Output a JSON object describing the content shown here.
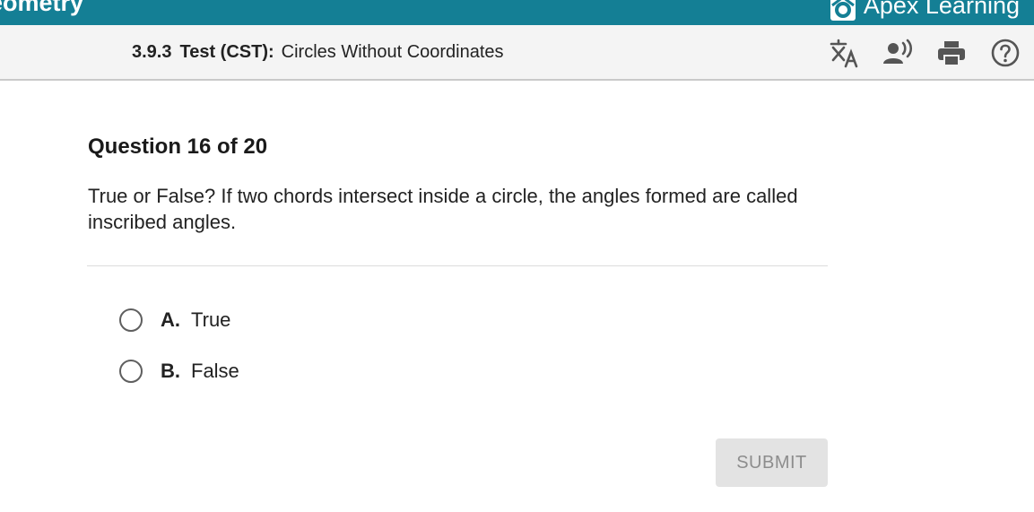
{
  "topbar": {
    "course_title": "eometry",
    "brand_name": "Apex Learning"
  },
  "test_header": {
    "section_number": "3.9.3",
    "test_type": "Test (CST):",
    "test_name": "Circles Without Coordinates"
  },
  "toolbar": {
    "icons": [
      "translate-icon",
      "text-to-speech-icon",
      "print-icon",
      "help-icon"
    ]
  },
  "question": {
    "heading": "Question 16 of 20",
    "text": "True or False? If two chords intersect inside a circle, the angles formed are called inscribed angles."
  },
  "choices": [
    {
      "letter": "A.",
      "text": "True"
    },
    {
      "letter": "B.",
      "text": "False"
    }
  ],
  "submit_label": "SUBMIT",
  "colors": {
    "topbar": "#147f95",
    "icon_gray": "#555555",
    "submit_disabled_bg": "#e3e3e3",
    "submit_disabled_text": "#8d8d8d"
  }
}
